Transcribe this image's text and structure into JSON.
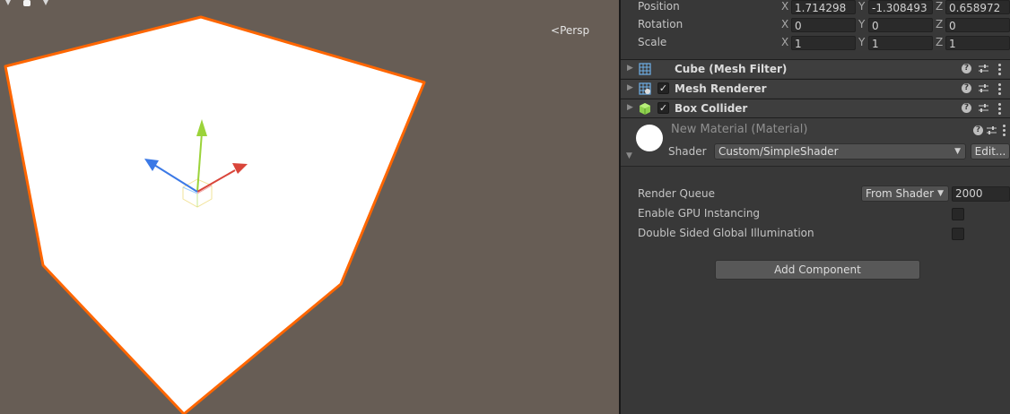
{
  "scene": {
    "persp_label": "Persp",
    "colors": {
      "background": "#675d55",
      "cube_face": "#ffffff",
      "selection_outline": "#ff6600",
      "gizmo_y": "#9bd33a",
      "gizmo_x": "#d9453a",
      "gizmo_z": "#3b79e6"
    }
  },
  "transform": {
    "position": {
      "label": "Position",
      "x": "1.714298",
      "y": "-1.308493",
      "z": "0.658972"
    },
    "rotation": {
      "label": "Rotation",
      "x": "0",
      "y": "0",
      "z": "0"
    },
    "scale": {
      "label": "Scale",
      "x": "1",
      "y": "1",
      "z": "1"
    },
    "axis_labels": {
      "x": "X",
      "y": "Y",
      "z": "Z"
    }
  },
  "components": [
    {
      "name": "Cube (Mesh Filter)",
      "icon": "mesh-filter-icon",
      "checkbox": false
    },
    {
      "name": "Mesh Renderer",
      "icon": "mesh-renderer-icon",
      "checkbox": true
    },
    {
      "name": "Box Collider",
      "icon": "box-collider-icon",
      "checkbox": true
    }
  ],
  "material": {
    "title": "New Material (Material)",
    "shader_label": "Shader",
    "shader_value": "Custom/SimpleShader",
    "edit_label": "Edit..."
  },
  "material_settings": {
    "render_queue_label": "Render Queue",
    "render_queue_mode": "From Shader",
    "render_queue_value": "2000",
    "gpu_instancing_label": "Enable GPU Instancing",
    "gpu_instancing_checked": false,
    "double_sided_gi_label": "Double Sided Global Illumination",
    "double_sided_gi_checked": false
  },
  "add_component_label": "Add Component",
  "checkmark_glyph": "✓",
  "help_glyph": "?"
}
